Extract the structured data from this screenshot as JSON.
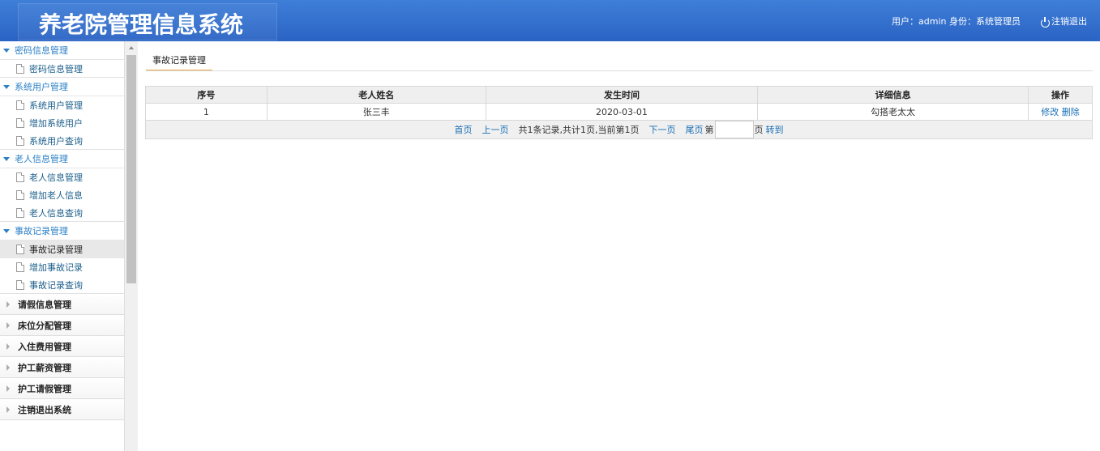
{
  "header": {
    "title": "养老院管理信息系统",
    "user_info": "用户：admin 身份：系统管理员",
    "logout": "注销退出"
  },
  "sidebar": {
    "groups": [
      {
        "label": "密码信息管理",
        "expanded": true,
        "items": [
          "密码信息管理"
        ]
      },
      {
        "label": "系统用户管理",
        "expanded": true,
        "items": [
          "系统用户管理",
          "增加系统用户",
          "系统用户查询"
        ]
      },
      {
        "label": "老人信息管理",
        "expanded": true,
        "items": [
          "老人信息管理",
          "增加老人信息",
          "老人信息查询"
        ]
      },
      {
        "label": "事故记录管理",
        "expanded": true,
        "items": [
          "事故记录管理",
          "增加事故记录",
          "事故记录查询"
        ]
      },
      {
        "label": "请假信息管理",
        "expanded": false
      },
      {
        "label": "床位分配管理",
        "expanded": false
      },
      {
        "label": "入住费用管理",
        "expanded": false
      },
      {
        "label": "护工薪资管理",
        "expanded": false
      },
      {
        "label": "护工请假管理",
        "expanded": false
      },
      {
        "label": "注销退出系统",
        "expanded": false
      }
    ],
    "active_item": "事故记录管理"
  },
  "main": {
    "tab": "事故记录管理",
    "table": {
      "headers": [
        "序号",
        "老人姓名",
        "发生时间",
        "详细信息",
        "操作"
      ],
      "rows": [
        {
          "id": "1",
          "name": "张三丰",
          "time": "2020-03-01",
          "detail": "勾搭老太太",
          "edit": "修改",
          "delete": "删除"
        }
      ]
    },
    "pager": {
      "first": "首页",
      "prev": "上一页",
      "summary": "共1条记录,共计1页,当前第1页",
      "next": "下一页",
      "last": "尾页",
      "page_prefix": "第",
      "page_suffix": "页",
      "goto": "转到",
      "page_input": ""
    }
  },
  "colors": {
    "header_bg": "#2a63c4",
    "link": "#1a6fb5",
    "tab_underline": "#e8a94a"
  }
}
